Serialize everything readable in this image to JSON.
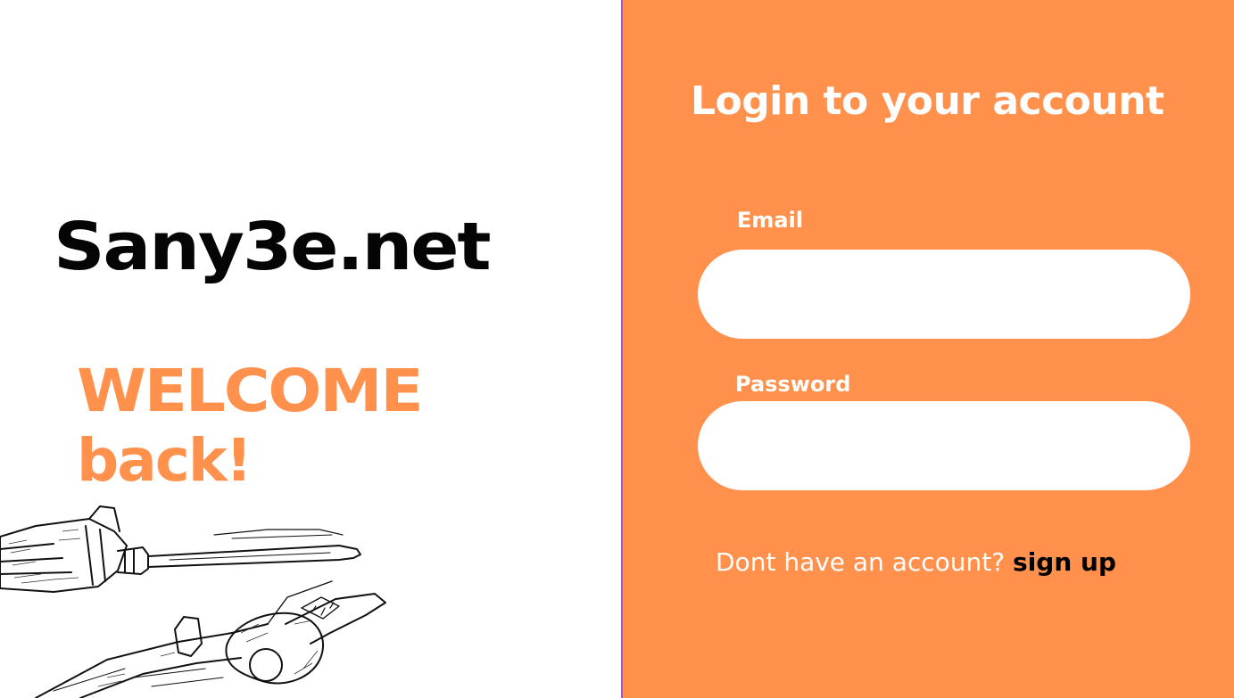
{
  "brand": {
    "name": "Sany3e.net"
  },
  "welcome": {
    "line1": "WELCOME",
    "line2": "back!"
  },
  "illustration": {
    "icon": "screwdriver-and-pliers-sketch"
  },
  "login": {
    "title": "Login to your account",
    "email_label": "Email",
    "email_value": "",
    "password_label": "Password",
    "password_value": "",
    "prompt_text": "Dont have an account?",
    "signup_label": "sign up"
  },
  "colors": {
    "accent": "#ff914d",
    "brand_text": "#050505",
    "panel_text": "#ffffff",
    "divider": "#8a5cf0",
    "link": "#000000"
  }
}
